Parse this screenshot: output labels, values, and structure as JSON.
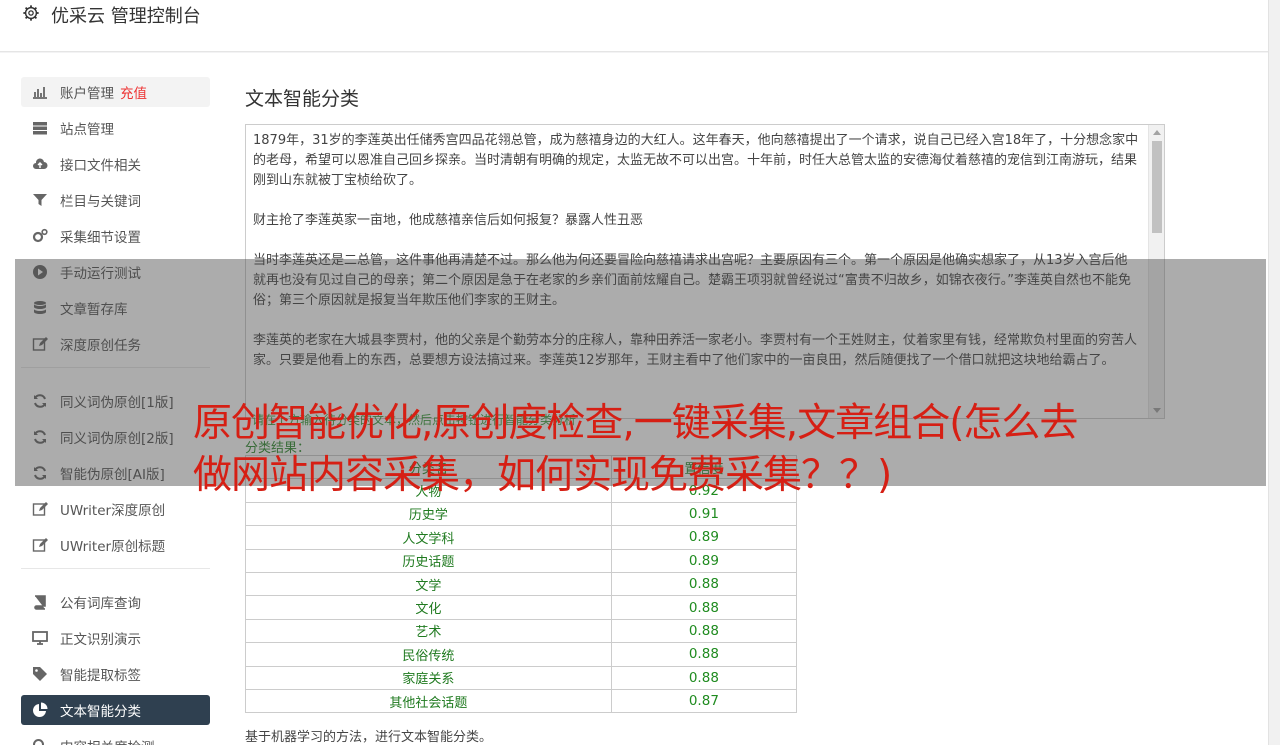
{
  "header": {
    "brand": "优采云 管理控制台",
    "icon": "gear-icon"
  },
  "sidebar": {
    "items": [
      {
        "label": "账户管理",
        "extra": "充值",
        "icon": "bar-chart-icon"
      },
      {
        "label": "站点管理",
        "icon": "server-icon"
      },
      {
        "label": "接口文件相关",
        "icon": "cloud-upload-icon"
      },
      {
        "label": "栏目与关键词",
        "icon": "filter-icon"
      },
      {
        "label": "采集细节设置",
        "icon": "cogs-icon"
      },
      {
        "label": "手动运行测试",
        "icon": "play-circle-icon"
      },
      {
        "label": "文章暂存库",
        "icon": "database-icon"
      },
      {
        "label": "深度原创任务",
        "icon": "edit-icon"
      },
      {
        "label": "同义词伪原创[1版]",
        "icon": "refresh-icon"
      },
      {
        "label": "同义词伪原创[2版]",
        "icon": "refresh-icon"
      },
      {
        "label": "智能伪原创[AI版]",
        "icon": "refresh-icon"
      },
      {
        "label": "UWriter深度原创",
        "icon": "edit-icon"
      },
      {
        "label": "UWriter原创标题",
        "icon": "edit-icon"
      },
      {
        "label": "公有词库查询",
        "icon": "book-icon"
      },
      {
        "label": "正文识别演示",
        "icon": "desktop-icon"
      },
      {
        "label": "智能提取标签",
        "icon": "tag-icon"
      },
      {
        "label": "文本智能分类",
        "icon": "pie-chart-icon"
      },
      {
        "label": "内容相关度检测",
        "icon": "search-icon"
      }
    ]
  },
  "main": {
    "title": "文本智能分类",
    "text_paragraphs": [
      "1879年，31岁的李莲英出任储秀宫四品花翎总管，成为慈禧身边的大红人。这年春天，他向慈禧提出了一个请求，说自己已经入宫18年了，十分想念家中的老母，希望可以恩准自己回乡探亲。当时清朝有明确的规定，太监无故不可以出宫。十年前，时任大总管太监的安德海仗着慈禧的宠信到江南游玩，结果刚到山东就被丁宝桢给砍了。",
      "财主抢了李莲英家一亩地，他成慈禧亲信后如何报复？暴露人性丑恶",
      "当时李莲英还是二总管，这件事他再清楚不过。那么他为何还要冒险向慈禧请求出宫呢？主要原因有三个。第一个原因是他确实想家了，从13岁入宫后他就再也没有见过自己的母亲；第二个原因是急于在老家的乡亲们面前炫耀自己。楚霸王项羽就曾经说过“富贵不归故乡，如锦衣夜行。”李莲英自然也不能免俗；第三个原因就是报复当年欺压他们李家的王财主。",
      "李莲英的老家在大城县李贾村，他的父亲是个勤劳本分的庄稼人，靠种田养活一家老小。李贾村有一个王姓财主，仗着家里有钱，经常欺负村里面的穷苦人家。只要是他看上的东西，总要想方设法搞过来。李莲英12岁那年，王财主看中了他们家中的一亩良田，然后随便找了一个借口就把这块地给霸占了。"
    ],
    "green_line": "请在上方输入待分类的文本，然后点击按钮进行智能分类分析",
    "result_label": "分类结果：",
    "table": {
      "headers": [
        "分类名",
        "置信度"
      ],
      "rows": [
        [
          "人物",
          "0.92"
        ],
        [
          "历史学",
          "0.91"
        ],
        [
          "人文学科",
          "0.89"
        ],
        [
          "历史话题",
          "0.89"
        ],
        [
          "文学",
          "0.88"
        ],
        [
          "文化",
          "0.88"
        ],
        [
          "艺术",
          "0.88"
        ],
        [
          "民俗传统",
          "0.88"
        ],
        [
          "家庭关系",
          "0.88"
        ],
        [
          "其他社会话题",
          "0.87"
        ]
      ]
    },
    "footer_note": "基于机器学习的方法，进行文本智能分类。"
  },
  "overlay": {
    "headline": "原创智能优化,原创度检查,一键采集,文章组合(怎么去做网站内容采集，如何实现免费采集？？)"
  },
  "colors": {
    "sidebar_active": "#2f4050",
    "accent_red": "#d61f14",
    "green": "#1f7a1f"
  }
}
